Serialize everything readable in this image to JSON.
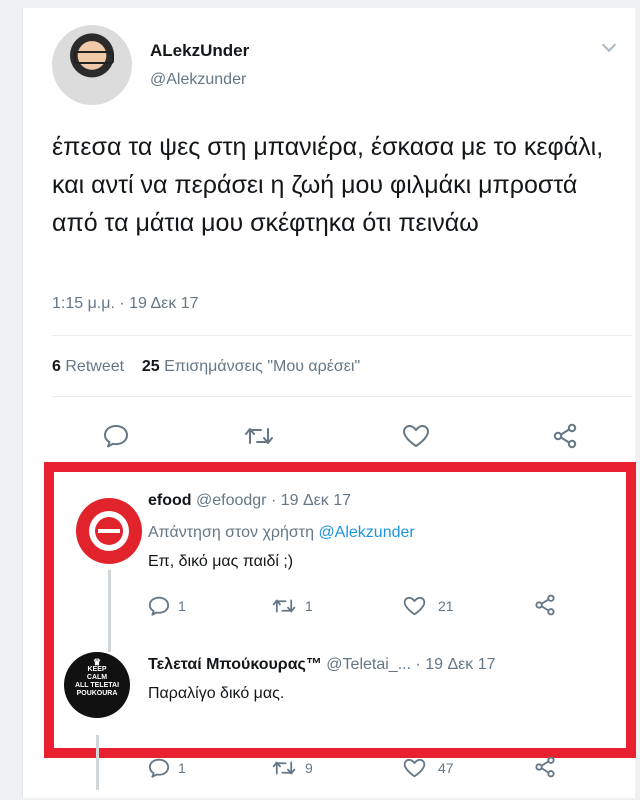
{
  "tweet": {
    "author_name": "ALekzUnder",
    "author_handle": "@Alekzunder",
    "text": "έπεσα τα ψες στη μπανιέρα, έσκασα με το κεφάλι, και αντί να περάσει η ζωή μου φιλμάκι μπροστά από τα μάτια μου σκέφτηκα ότι πεινάω",
    "time": "1:15 μ.μ. · 19 Δεκ 17",
    "retweet_count": "6",
    "retweet_label": "Retweet",
    "like_count": "25",
    "like_label": "Επισημάνσεις \"Μου αρέσει\""
  },
  "replies": [
    {
      "name": "efood",
      "handle_date": "@efoodgr · 19 Δεκ 17",
      "reply_to_prefix": "Απάντηση στον χρήστη",
      "reply_to_mention": "@Alekzunder",
      "text": "Επ, δικό μας παιδί ;)",
      "reply_count": "1",
      "retweet_count": "1",
      "like_count": "21"
    },
    {
      "name": "Τελεταί Μπούκουρας™",
      "handle_date": "@Teletai_... · 19 Δεκ 17",
      "text": "Παραλίγο δικό μας.",
      "avatar_lines": [
        "KEEP",
        "CALM",
        "ALL TELETAI",
        "POUKOURA"
      ],
      "reply_count": "1",
      "retweet_count": "9",
      "like_count": "47"
    }
  ],
  "colors": {
    "highlight_border": "#e8202f",
    "efood_brand": "#e1242c",
    "mention": "#1b95e0",
    "secondary_text": "#657786"
  },
  "icons": [
    "reply-icon",
    "retweet-icon",
    "like-icon",
    "share-icon",
    "chevron-down-icon"
  ]
}
